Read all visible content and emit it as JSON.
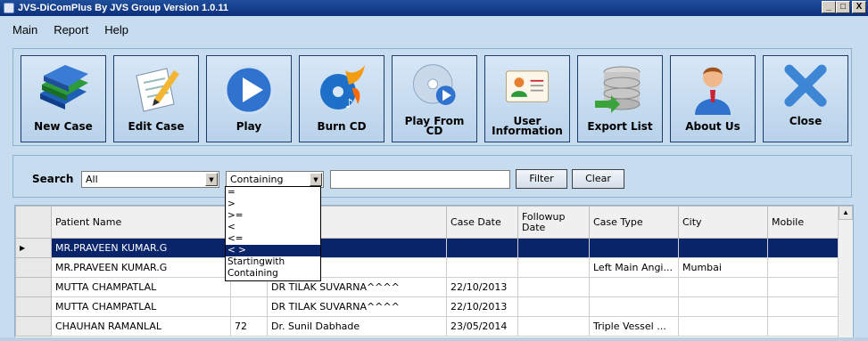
{
  "window": {
    "title": "JVS-DiComPlus By JVS Group Version 1.0.11",
    "min": "_",
    "max": "□",
    "close": "X"
  },
  "menu": [
    "Main",
    "Report",
    "Help"
  ],
  "toolbar": [
    {
      "label": "New Case",
      "icon": "books-icon"
    },
    {
      "label": "Edit Case",
      "icon": "edit-document-icon"
    },
    {
      "label": "Play",
      "icon": "play-icon"
    },
    {
      "label": "Burn CD",
      "icon": "burn-cd-icon"
    },
    {
      "label": "Play From CD",
      "line1": "Play From",
      "line2": "CD",
      "icon": "cd-play-icon"
    },
    {
      "label": "User Information",
      "line1": "User",
      "line2": "Information",
      "icon": "user-card-icon"
    },
    {
      "label": "Export List",
      "icon": "database-export-icon"
    },
    {
      "label": "About Us",
      "icon": "person-icon"
    },
    {
      "label": "Close",
      "icon": "close-x-icon"
    }
  ],
  "search": {
    "label": "Search",
    "field_value": "All",
    "operator_value": "Containing",
    "text_value": "",
    "filter_label": "Filter",
    "clear_label": "Clear"
  },
  "operator_options": [
    "=",
    ">",
    ">=",
    "<",
    "<=",
    "< >",
    "Startingwith",
    "Containing"
  ],
  "operator_selected_index": 5,
  "grid": {
    "columns": [
      "Patient Name",
      "",
      "me",
      "Case Date",
      "Followup Date",
      "Case Type",
      "City",
      "Mobile"
    ],
    "rows": [
      {
        "name": "MR.PRAVEEN KUMAR.G",
        "age": "",
        "doctor": "",
        "case_date": "",
        "followup": "",
        "case_type": "",
        "city": "",
        "mobile": "",
        "selected": true
      },
      {
        "name": "MR.PRAVEEN KUMAR.G",
        "age": "",
        "doctor": "DIOLOGY",
        "case_date": "",
        "followup": "",
        "case_type": "Left Main Angi...",
        "city": "Mumbai",
        "mobile": ""
      },
      {
        "name": "MUTTA CHAMPATLAL",
        "age": "",
        "doctor": "DR TILAK SUVARNA^^^^",
        "case_date": "22/10/2013",
        "followup": "",
        "case_type": "",
        "city": "",
        "mobile": ""
      },
      {
        "name": "MUTTA CHAMPATLAL",
        "age": "",
        "doctor": "DR TILAK SUVARNA^^^^",
        "case_date": "22/10/2013",
        "followup": "",
        "case_type": "",
        "city": "",
        "mobile": ""
      },
      {
        "name": "CHAUHAN RAMANLAL",
        "age": "72",
        "doctor": "Dr. Sunil Dabhade",
        "case_date": "23/05/2014",
        "followup": "",
        "case_type": "Triple Vessel ...",
        "city": "",
        "mobile": ""
      }
    ]
  },
  "colors": {
    "titlebar": "#0c2f7a",
    "background": "#c7dcef",
    "selection": "#0a246a"
  }
}
